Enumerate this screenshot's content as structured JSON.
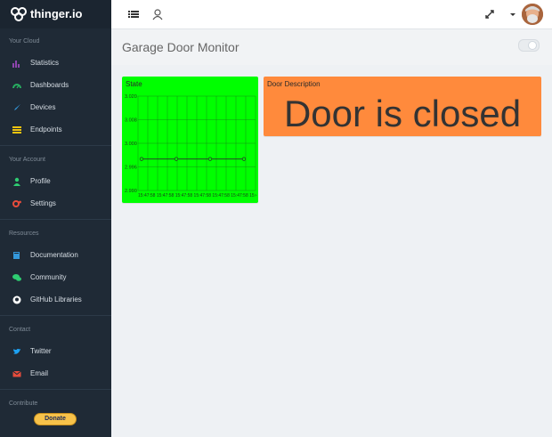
{
  "brand": {
    "name": "thinger.io"
  },
  "sidebar": {
    "sections": [
      {
        "title": "Your Cloud",
        "items": [
          {
            "label": "Statistics",
            "icon": "chart-icon",
            "color": "#8e44ad"
          },
          {
            "label": "Dashboards",
            "icon": "dashboard-icon",
            "color": "#27ae60"
          },
          {
            "label": "Devices",
            "icon": "rocket-icon",
            "color": "#3498db"
          },
          {
            "label": "Endpoints",
            "icon": "list-icon",
            "color": "#f1c40f"
          }
        ]
      },
      {
        "title": "Your Account",
        "items": [
          {
            "label": "Profile",
            "icon": "user-icon",
            "color": "#2ecc71"
          },
          {
            "label": "Settings",
            "icon": "gear-icon",
            "color": "#e74c3c"
          }
        ]
      },
      {
        "title": "Resources",
        "items": [
          {
            "label": "Documentation",
            "icon": "book-icon",
            "color": "#3498db"
          },
          {
            "label": "Community",
            "icon": "comments-icon",
            "color": "#2ecc71"
          },
          {
            "label": "GitHub Libraries",
            "icon": "github-icon",
            "color": "#ffffff"
          }
        ]
      },
      {
        "title": "Contact",
        "items": [
          {
            "label": "Twitter",
            "icon": "twitter-icon",
            "color": "#1da1f2"
          },
          {
            "label": "Email",
            "icon": "email-icon",
            "color": "#e74c3c"
          }
        ]
      },
      {
        "title": "Contribute",
        "items": []
      }
    ],
    "donate_label": "Donate"
  },
  "page": {
    "title": "Garage Door Monitor"
  },
  "widgets": {
    "state": {
      "title": "State",
      "yticks": [
        "3.020",
        "3.008",
        "3.000",
        "2.996",
        "2.990"
      ],
      "xticks_text": "15:47:58 15:47:58 15:47:58 15:47:58 15:47:58 15:47:58 15:47:58 15:47:58 15:47:58"
    },
    "door": {
      "title": "Door Description",
      "value": "Door is closed"
    }
  },
  "chart_data": {
    "type": "line",
    "title": "State",
    "x": [
      "15:47:58",
      "15:47:58",
      "15:47:58",
      "15:47:58"
    ],
    "series": [
      {
        "values": [
          3.0,
          3.0,
          3.0,
          3.0
        ]
      }
    ],
    "ylim": [
      2.99,
      3.02
    ],
    "grid": true
  }
}
